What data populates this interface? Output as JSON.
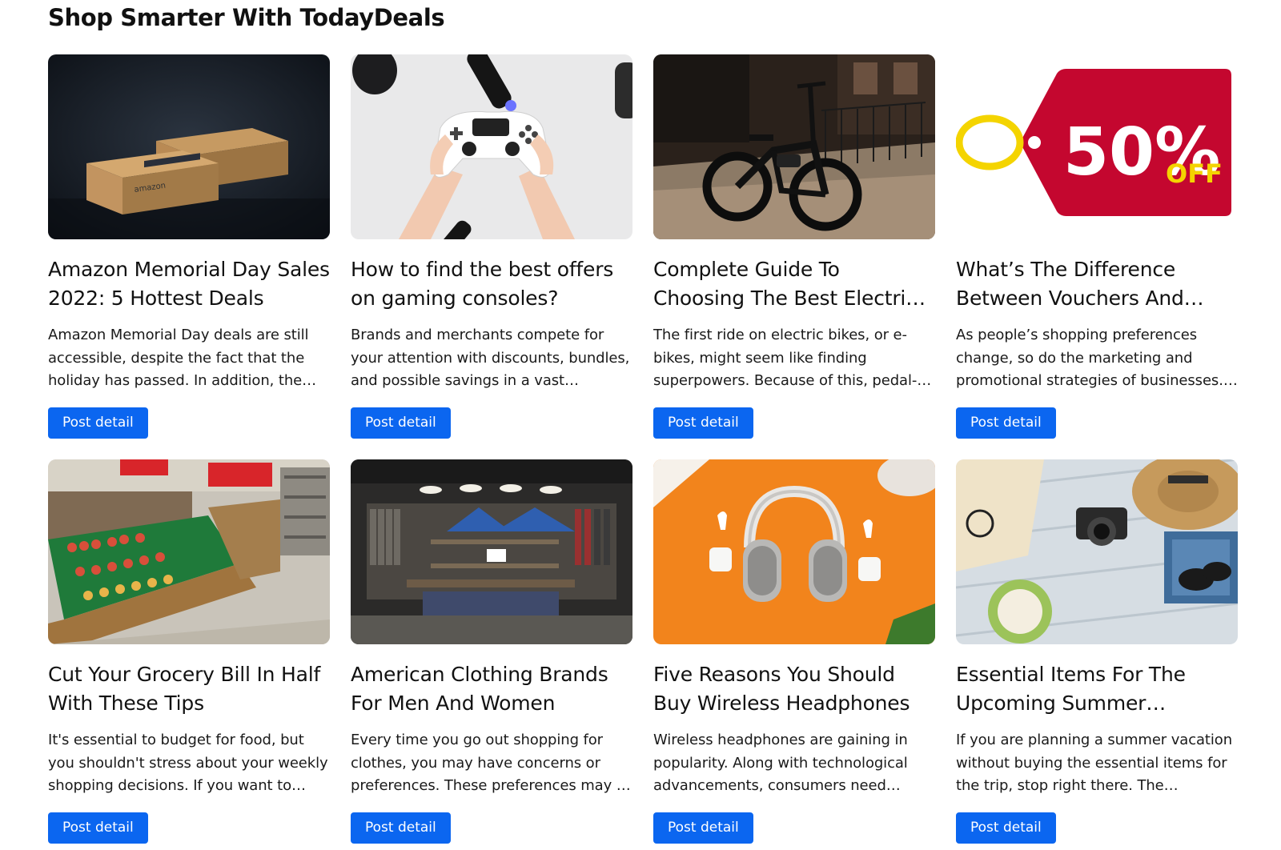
{
  "section": {
    "title": "Shop Smarter With TodayDeals"
  },
  "colors": {
    "accent": "#0b66f0"
  },
  "cards": [
    {
      "image": "amazon-boxes-image",
      "title": "Amazon Memorial Day Sales 2022: 5 Hottest Deals",
      "excerpt": "Amazon Memorial Day deals are still accessible, despite the fact that the holiday has passed. In addition, the…",
      "button_label": "Post detail"
    },
    {
      "image": "game-controller-image",
      "title": "How to find the best offers on gaming consoles?",
      "excerpt": "Brands and merchants compete for your attention with discounts, bundles, and possible savings in a vast…",
      "button_label": "Post detail"
    },
    {
      "image": "electric-bike-image",
      "title": "Complete Guide To Choosing The Best Electric Bike",
      "excerpt": "The first ride on electric bikes, or e-bikes, might seem like finding superpowers. Because of this, pedal-…",
      "button_label": "Post detail"
    },
    {
      "image": "discount-tag-image",
      "image_text": {
        "percent": "50%",
        "off": "OFF"
      },
      "title": "What’s The Difference Between Vouchers And…",
      "excerpt": "As people’s shopping preferences change, so do the marketing and promotional strategies of businesses.…",
      "button_label": "Post detail"
    },
    {
      "image": "grocery-store-image",
      "title": "Cut Your Grocery Bill In Half With These Tips",
      "excerpt": "It's essential to budget for food, but you shouldn't stress about your weekly shopping decisions. If you want to sav…",
      "button_label": "Post detail"
    },
    {
      "image": "clothing-store-image",
      "title": "American Clothing Brands For Men And Women",
      "excerpt": "Every time you go out shopping for clothes, you may have concerns or preferences. These preferences may …",
      "button_label": "Post detail"
    },
    {
      "image": "headphones-image",
      "title": "Five Reasons You Should Buy Wireless Headphones",
      "excerpt": "Wireless headphones are gaining in popularity. Along with technological advancements, consumers need…",
      "button_label": "Post detail"
    },
    {
      "image": "summer-items-image",
      "title": "Essential Items For The Upcoming Summer Weeken…",
      "excerpt": "If you are planning a summer vacation without buying the essential items for the trip, stop right there. The differen…",
      "button_label": "Post detail"
    }
  ]
}
